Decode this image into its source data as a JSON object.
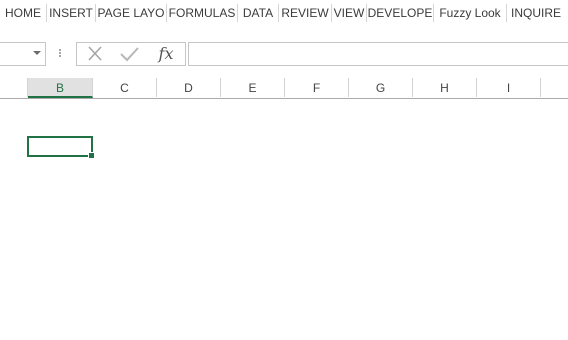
{
  "ribbon": {
    "tabs": [
      {
        "label": "HOME"
      },
      {
        "label": "INSERT"
      },
      {
        "label": "PAGE LAYO"
      },
      {
        "label": "FORMULAS"
      },
      {
        "label": "DATA"
      },
      {
        "label": "REVIEW"
      },
      {
        "label": "VIEW"
      },
      {
        "label": "DEVELOPE"
      },
      {
        "label": "Fuzzy Look"
      },
      {
        "label": "INQUIRE"
      }
    ]
  },
  "formula_bar": {
    "name_box_value": "",
    "formula_value": "",
    "cancel_icon": "x-icon",
    "enter_icon": "check-icon",
    "function_label": "fx"
  },
  "sheet": {
    "columns": [
      "B",
      "C",
      "D",
      "E",
      "F",
      "G",
      "H",
      "I"
    ],
    "selected_column": "B",
    "active_cell": "B3"
  },
  "colors": {
    "accent": "#217346",
    "selected_header_bg": "#e1e1e1"
  }
}
